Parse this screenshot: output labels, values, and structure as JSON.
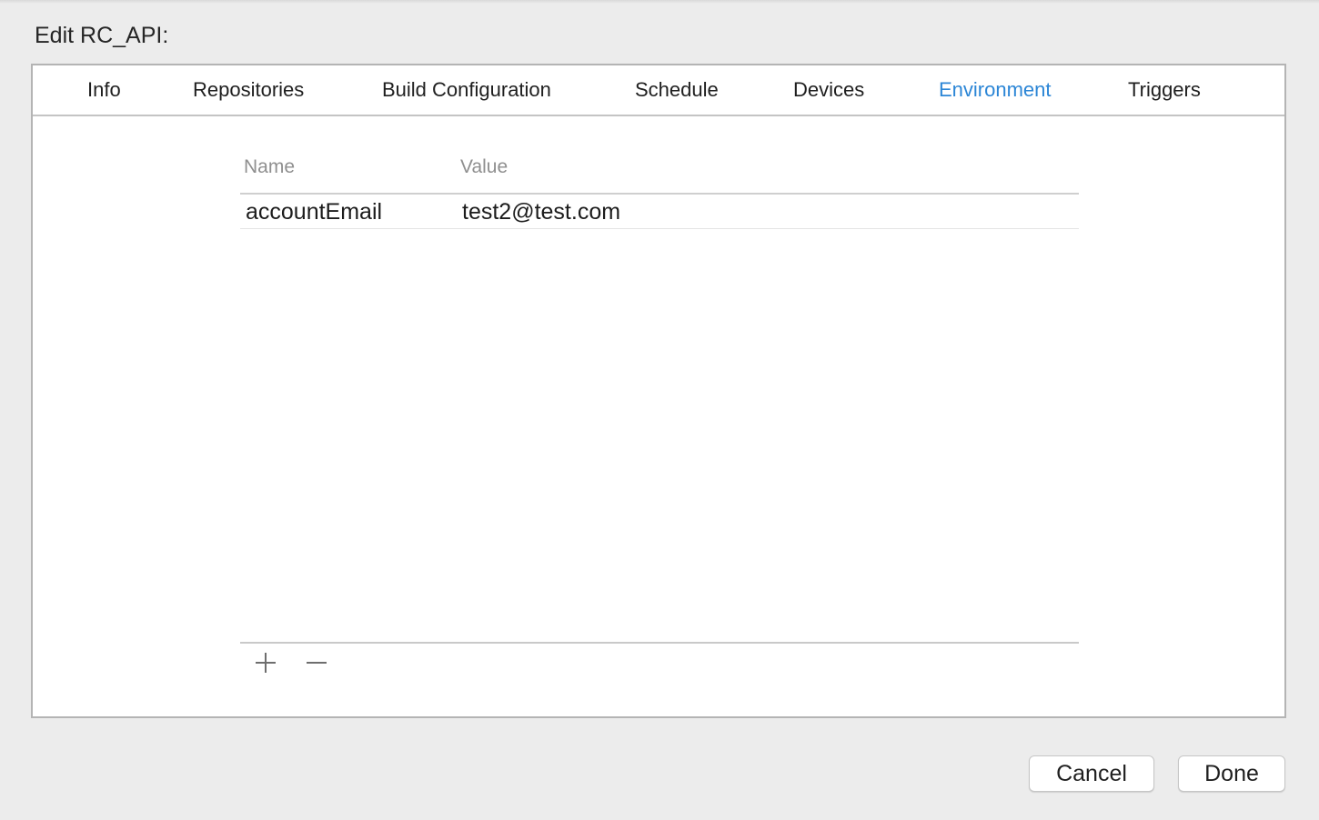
{
  "dialog": {
    "title": "Edit RC_API:"
  },
  "tabs": [
    {
      "label": "Info",
      "selected": false
    },
    {
      "label": "Repositories",
      "selected": false
    },
    {
      "label": "Build Configuration",
      "selected": false
    },
    {
      "label": "Schedule",
      "selected": false
    },
    {
      "label": "Devices",
      "selected": false
    },
    {
      "label": "Environment",
      "selected": true
    },
    {
      "label": "Triggers",
      "selected": false
    }
  ],
  "environment_table": {
    "columns": [
      "Name",
      "Value"
    ],
    "rows": [
      {
        "name": "accountEmail",
        "value": "test2@test.com"
      }
    ]
  },
  "table_controls": {
    "add_icon": "plus-icon",
    "remove_icon": "minus-icon"
  },
  "buttons": {
    "cancel_label": "Cancel",
    "done_label": "Done"
  },
  "colors": {
    "selected_tab": "#2c86d6",
    "window_background": "#ececec",
    "panel_background": "#ffffff"
  }
}
